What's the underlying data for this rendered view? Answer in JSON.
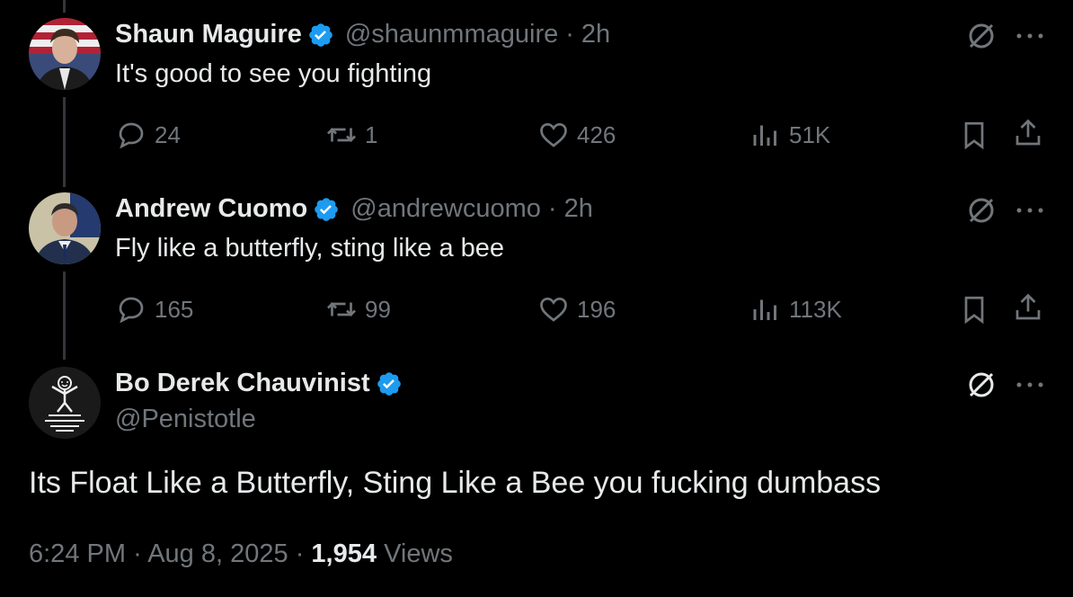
{
  "replies": [
    {
      "name": "Shaun Maguire",
      "handle": "@shaunmmaguire",
      "separator": "·",
      "time": "2h",
      "text": "It's good to see you fighting",
      "replies": "24",
      "reposts": "1",
      "likes": "426",
      "views": "51K"
    },
    {
      "name": "Andrew Cuomo",
      "handle": "@andrewcuomo",
      "separator": "·",
      "time": "2h",
      "text": "Fly like a butterfly, sting like a bee",
      "replies": "165",
      "reposts": "99",
      "likes": "196",
      "views": "113K"
    }
  ],
  "main_post": {
    "name": "Bo Derek Chauvinist",
    "handle": "@Penistotle",
    "text": "Its Float Like a Butterfly, Sting Like a Bee you fucking dumbass",
    "time": "6:24 PM",
    "date": "Aug 8, 2025",
    "sep": "·",
    "views_count": "1,954",
    "views_label": "Views"
  },
  "colors": {
    "background": "#000000",
    "text": "#e7e9ea",
    "muted": "#71767b",
    "verified": "#1d9bf0"
  },
  "icons": [
    "reply-icon",
    "repost-icon",
    "like-icon",
    "views-icon",
    "bookmark-icon",
    "share-icon",
    "grok-icon",
    "more-icon",
    "verified-badge-icon"
  ]
}
